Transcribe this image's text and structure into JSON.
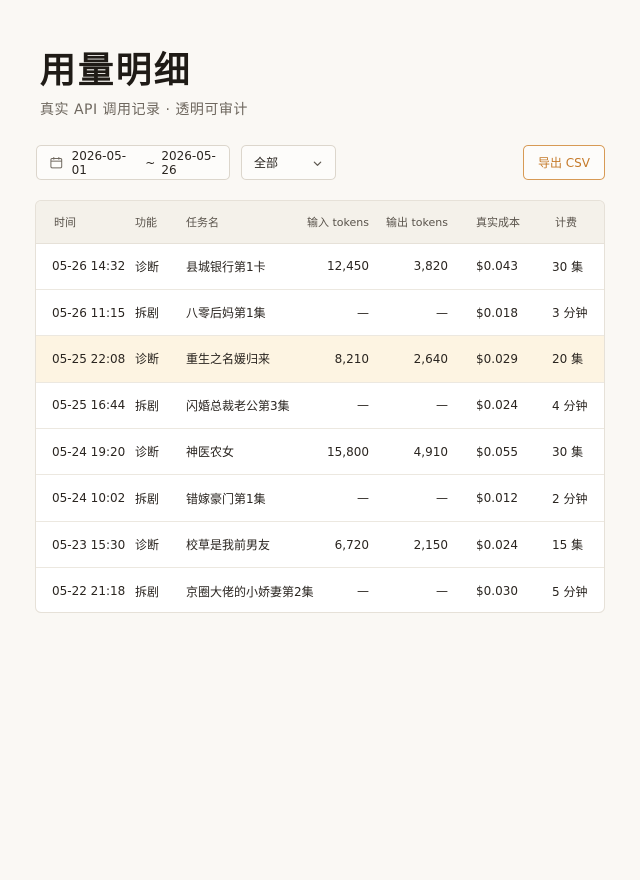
{
  "page": {
    "title": "用量明细",
    "subtitle": "真实 API 调用记录 · 透明可审计"
  },
  "toolbar": {
    "date_icon": "calendar-icon",
    "date_start": "2026-05-01",
    "date_separator": "~",
    "date_end": "2026-05-26",
    "filter_value": "全部",
    "filter_icon": "chevron-down-icon",
    "export_label": "导出 CSV",
    "export_color": "#c57a2a"
  },
  "table": {
    "headers": {
      "time": "时间",
      "func": "功能",
      "task": "任务名",
      "input_tokens": "输入 tokens",
      "output_tokens": "输出 tokens",
      "cost": "真实成本",
      "billing": "计费"
    },
    "highlight_color": "#fdf4e2",
    "rows": [
      {
        "time": "05-26 14:32",
        "func": "诊断",
        "task": "县城银行第1卡",
        "input_tokens": "12,450",
        "output_tokens": "3,820",
        "cost": "$0.043",
        "billing": "30 集"
      },
      {
        "time": "05-26 11:15",
        "func": "拆剧",
        "task": "八零后妈第1集",
        "input_tokens": "—",
        "output_tokens": "—",
        "cost": "$0.018",
        "billing": "3 分钟"
      },
      {
        "time": "05-25 22:08",
        "func": "诊断",
        "task": "重生之名媛归来",
        "input_tokens": "8,210",
        "output_tokens": "2,640",
        "cost": "$0.029",
        "billing": "20 集"
      },
      {
        "time": "05-25 16:44",
        "func": "拆剧",
        "task": "闪婚总裁老公第3集",
        "input_tokens": "—",
        "output_tokens": "—",
        "cost": "$0.024",
        "billing": "4 分钟"
      },
      {
        "time": "05-24 19:20",
        "func": "诊断",
        "task": "神医农女",
        "input_tokens": "15,800",
        "output_tokens": "4,910",
        "cost": "$0.055",
        "billing": "30 集"
      },
      {
        "time": "05-24 10:02",
        "func": "拆剧",
        "task": "错嫁豪门第1集",
        "input_tokens": "—",
        "output_tokens": "—",
        "cost": "$0.012",
        "billing": "2 分钟"
      },
      {
        "time": "05-23 15:30",
        "func": "诊断",
        "task": "校草是我前男友",
        "input_tokens": "6,720",
        "output_tokens": "2,150",
        "cost": "$0.024",
        "billing": "15 集"
      },
      {
        "time": "05-22 21:18",
        "func": "拆剧",
        "task": "京圈大佬的小娇妻第2集",
        "input_tokens": "—",
        "output_tokens": "—",
        "cost": "$0.030",
        "billing": "5 分钟"
      }
    ]
  }
}
